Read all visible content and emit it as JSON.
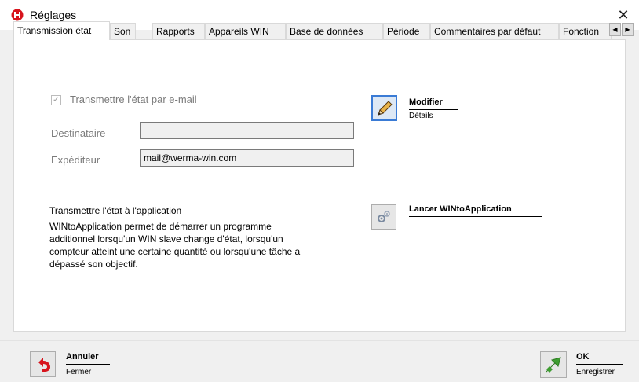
{
  "window": {
    "title": "Réglages",
    "icon": "werma-logo-icon",
    "close_glyph": "✕"
  },
  "tabs": [
    {
      "label": "Transmission état",
      "active": true
    },
    {
      "label": "Son",
      "active": false
    },
    {
      "label": "Rapports",
      "active": false
    },
    {
      "label": "Appareils WIN",
      "active": false
    },
    {
      "label": "Base de données",
      "active": false
    },
    {
      "label": "Période",
      "active": false
    },
    {
      "label": "Commentaires par défaut",
      "active": false
    },
    {
      "label": "Fonction",
      "active": false
    }
  ],
  "tab_scroll": {
    "left": "◀",
    "right": "▶"
  },
  "email_section": {
    "checkbox_label": "Transmettre l'état par e-mail",
    "checked": true,
    "recipient_label": "Destinataire",
    "recipient_value": "",
    "sender_label": "Expéditeur",
    "sender_value": "mail@werma-win.com",
    "modify": {
      "title": "Modifier",
      "subtitle": "Détails",
      "icon": "pencil-icon"
    }
  },
  "app_section": {
    "heading": "Transmettre l'état à l'application",
    "description_lines": [
      "WINtoApplication permet de démarrer un programme",
      "additionnel lorsqu'un WIN slave change d'état, lorsqu'un",
      "compteur atteint une certaine quantité ou lorsqu'une tâche a",
      "dépassé son objectif."
    ],
    "launch": {
      "title": "Lancer WINtoApplication",
      "icon": "gears-icon"
    }
  },
  "footer": {
    "cancel": {
      "title": "Annuler",
      "subtitle": "Fermer",
      "icon": "undo-arrow-icon"
    },
    "ok": {
      "title": "OK",
      "subtitle": "Enregistrer",
      "icon": "green-arrow-icon"
    }
  },
  "colors": {
    "logo_red": "#d7141d",
    "ok_green": "#3f9e32",
    "cancel_red": "#d7141d"
  }
}
